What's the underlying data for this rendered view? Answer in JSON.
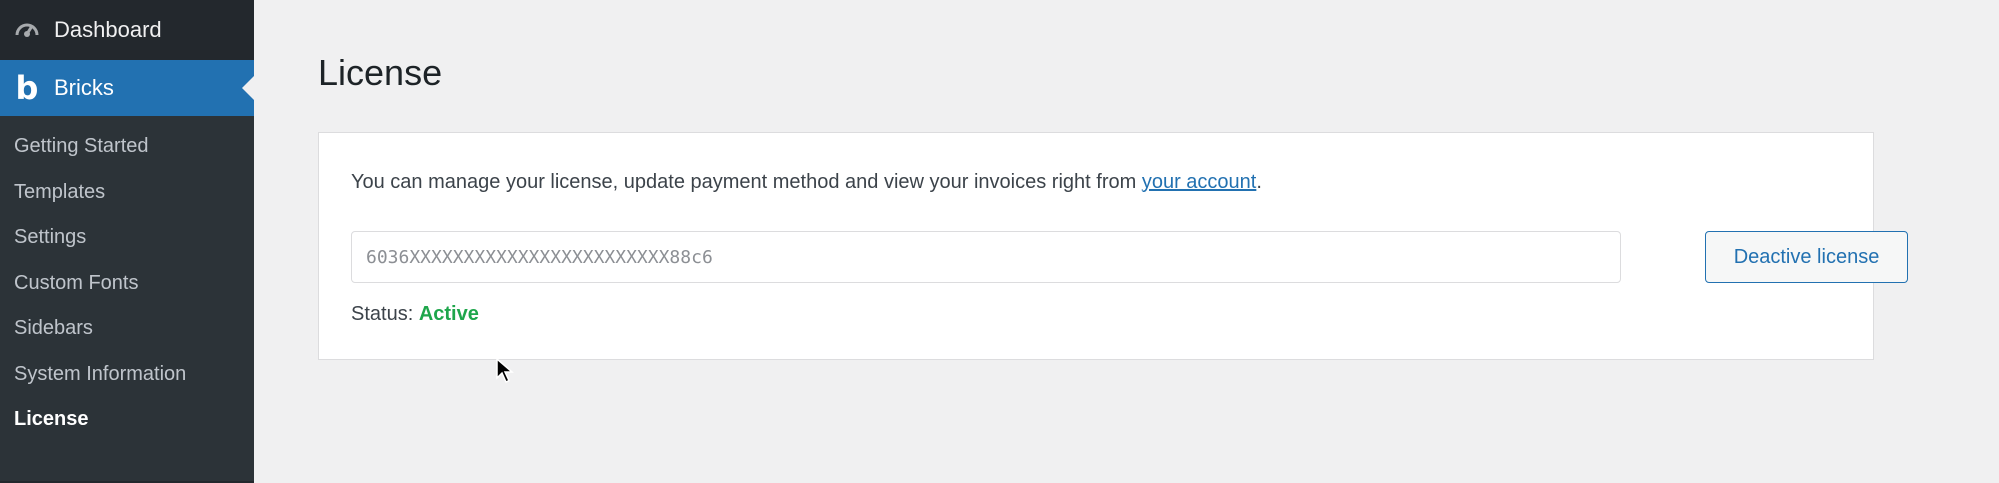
{
  "sidebar": {
    "dashboard_label": "Dashboard",
    "bricks_label": "Bricks",
    "bricks_icon": "b",
    "submenu": [
      {
        "label": "Getting Started"
      },
      {
        "label": "Templates"
      },
      {
        "label": "Settings"
      },
      {
        "label": "Custom Fonts"
      },
      {
        "label": "Sidebars"
      },
      {
        "label": "System Information"
      },
      {
        "label": "License"
      }
    ],
    "colors": {
      "bg": "#23282d",
      "active": "#2271b1"
    }
  },
  "main": {
    "title": "License",
    "intro_text": "You can manage your license, update payment method and view your invoices right from ",
    "intro_link": "your account",
    "intro_end": ".",
    "license_key": "6036XXXXXXXXXXXXXXXXXXXXXXXX88c6",
    "deactivate_label": "Deactive license",
    "status_label": "Status: ",
    "status_value": "Active",
    "status_color": "#1ea64b"
  }
}
